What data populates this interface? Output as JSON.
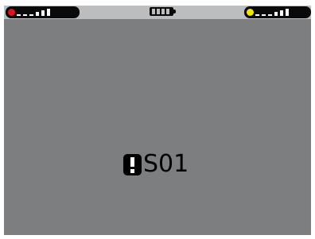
{
  "status_bar": {
    "left_indicator": {
      "dot_color": "#e0141a",
      "icon": "signal-strength-icon",
      "bar_count": 6
    },
    "battery": {
      "icon": "battery-icon",
      "level": 1.0
    },
    "right_indicator": {
      "dot_color": "#f2e600",
      "icon": "signal-strength-icon",
      "bar_count": 6
    }
  },
  "alert": {
    "icon": "exclamation-alert-icon",
    "code": "S01"
  }
}
